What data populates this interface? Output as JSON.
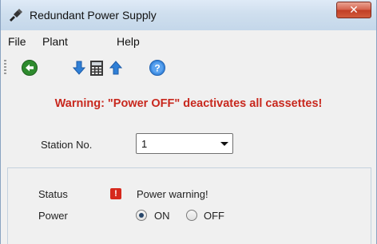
{
  "window": {
    "title": "Redundant Power Supply",
    "close_label": "✕"
  },
  "menu": {
    "items": [
      {
        "label": "File"
      },
      {
        "label": "Plant"
      },
      {
        "label": "Help"
      }
    ]
  },
  "toolbar": {
    "icons": [
      "back-icon",
      "download-icon",
      "calculator-icon",
      "upload-icon",
      "help-icon"
    ]
  },
  "content": {
    "warning": "Warning: \"Power OFF\" deactivates all cassettes!",
    "station_label": "Station No.",
    "station_value": "1"
  },
  "status_panel": {
    "status_label": "Status",
    "status_icon_glyph": "!",
    "status_text": "Power warning!",
    "power_label": "Power",
    "options": [
      {
        "label": "ON",
        "selected": true
      },
      {
        "label": "OFF",
        "selected": false
      }
    ]
  },
  "colors": {
    "warning": "#c8281e",
    "status_icon": "#d6281c",
    "toolbar_blue": "#2f7fd6",
    "back_green": "#2e8b2e"
  }
}
